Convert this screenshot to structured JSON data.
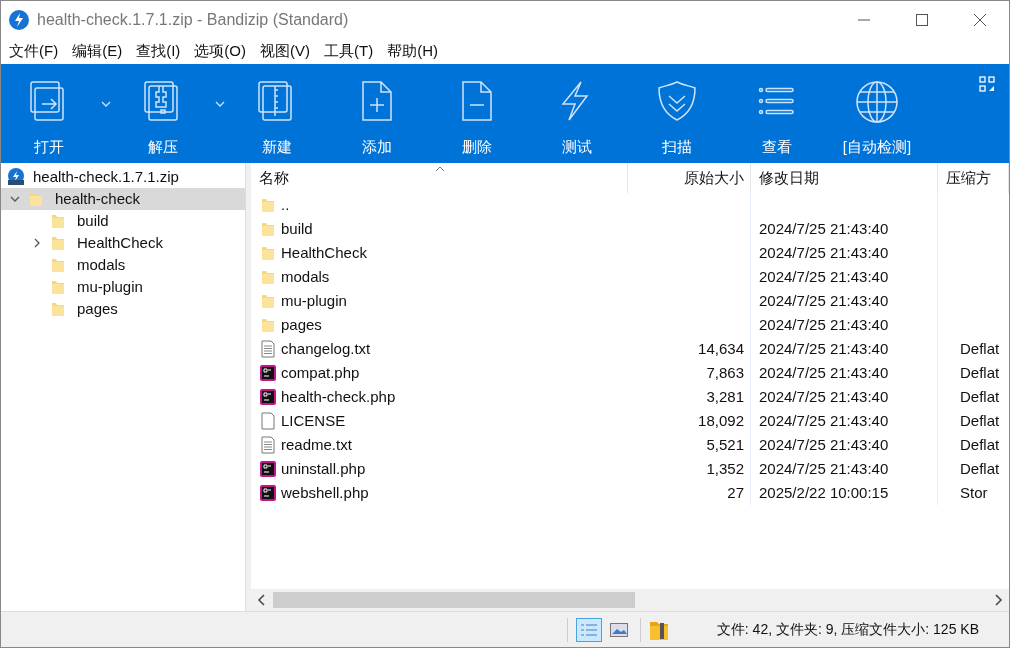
{
  "window": {
    "title": "health-check.1.7.1.zip - Bandizip (Standard)"
  },
  "menu": [
    "文件(F)",
    "编辑(E)",
    "查找(I)",
    "选项(O)",
    "视图(V)",
    "工具(T)",
    "帮助(H)"
  ],
  "toolbar": [
    {
      "label": "打开",
      "dropdown": true
    },
    {
      "label": "解压",
      "dropdown": true
    },
    {
      "label": "新建",
      "dropdown": false
    },
    {
      "label": "添加",
      "dropdown": false
    },
    {
      "label": "删除",
      "dropdown": false
    },
    {
      "label": "测试",
      "dropdown": false
    },
    {
      "label": "扫描",
      "dropdown": false
    },
    {
      "label": "查看",
      "dropdown": false
    },
    {
      "label": "[自动检测]",
      "dropdown": false
    }
  ],
  "tree": {
    "label": "health-check.1.7.1.zip",
    "children": [
      {
        "label": "health-check",
        "selected": true,
        "expanded": true,
        "children": [
          {
            "label": "build",
            "selected": false
          },
          {
            "label": "HealthCheck",
            "selected": false,
            "expanded": false
          },
          {
            "label": "modals",
            "selected": false
          },
          {
            "label": "mu-plugin",
            "selected": false
          },
          {
            "label": "pages",
            "selected": false
          }
        ]
      }
    ]
  },
  "table": {
    "columns": [
      "名称",
      "原始大小",
      "修改日期",
      "压缩方"
    ],
    "rows": [
      {
        "kind": "folder",
        "name": "..",
        "size": "",
        "date": "",
        "method": ""
      },
      {
        "kind": "folder",
        "name": "build",
        "size": "",
        "date": "2024/7/25 21:43:40",
        "method": ""
      },
      {
        "kind": "folder",
        "name": "HealthCheck",
        "size": "",
        "date": "2024/7/25 21:43:40",
        "method": ""
      },
      {
        "kind": "folder",
        "name": "modals",
        "size": "",
        "date": "2024/7/25 21:43:40",
        "method": ""
      },
      {
        "kind": "folder",
        "name": "mu-plugin",
        "size": "",
        "date": "2024/7/25 21:43:40",
        "method": ""
      },
      {
        "kind": "folder",
        "name": "pages",
        "size": "",
        "date": "2024/7/25 21:43:40",
        "method": ""
      },
      {
        "kind": "text",
        "name": "changelog.txt",
        "size": "14,634",
        "date": "2024/7/25 21:43:40",
        "method": "Deflat"
      },
      {
        "kind": "php",
        "name": "compat.php",
        "size": "7,863",
        "date": "2024/7/25 21:43:40",
        "method": "Deflat"
      },
      {
        "kind": "php",
        "name": "health-check.php",
        "size": "3,281",
        "date": "2024/7/25 21:43:40",
        "method": "Deflat"
      },
      {
        "kind": "blank",
        "name": "LICENSE",
        "size": "18,092",
        "date": "2024/7/25 21:43:40",
        "method": "Deflat"
      },
      {
        "kind": "text",
        "name": "readme.txt",
        "size": "5,521",
        "date": "2024/7/25 21:43:40",
        "method": "Deflat"
      },
      {
        "kind": "php",
        "name": "uninstall.php",
        "size": "1,352",
        "date": "2024/7/25 21:43:40",
        "method": "Deflat"
      },
      {
        "kind": "php",
        "name": "webshell.php",
        "size": "27",
        "date": "2025/2/22 10:00:15",
        "method": "Stor"
      }
    ]
  },
  "status_bar": {
    "view_buttons": [
      {
        "selected": true
      },
      {
        "selected": false
      }
    ],
    "text": "文件: 42, 文件夹: 9, 压缩文件大小: 125 KB"
  }
}
